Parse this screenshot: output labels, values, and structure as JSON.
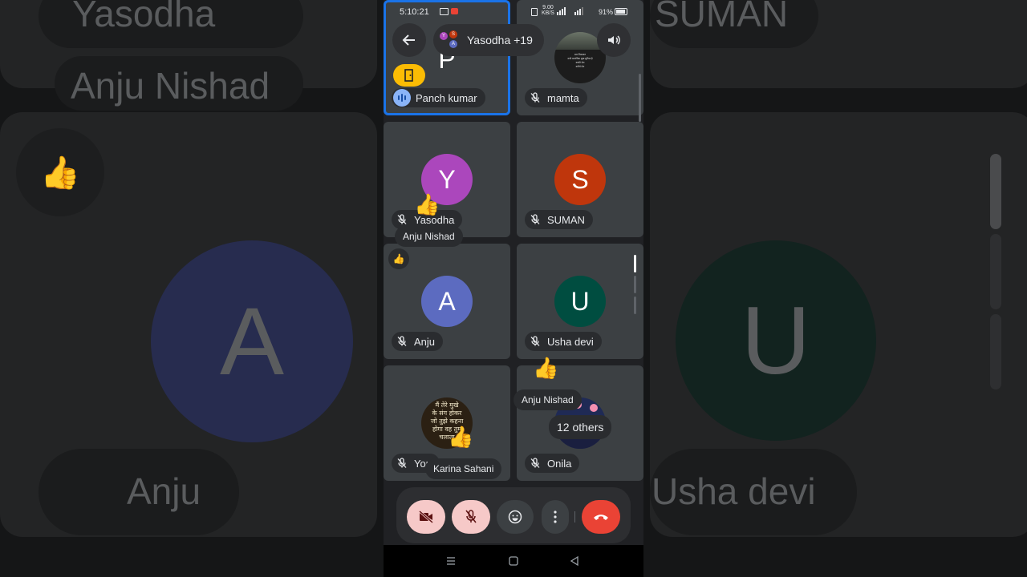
{
  "status_bar": {
    "time": "5:10:21",
    "net_speed_top": "9.00",
    "net_speed_bottom": "KB/S",
    "battery": "91%"
  },
  "header": {
    "participants_chip": "Yasodha +19",
    "mini_avatars": [
      "Y",
      "S",
      "A"
    ]
  },
  "tiles": [
    {
      "name": "Panch kumar",
      "initial": "P",
      "color": "#5c6bc0",
      "speaking": true,
      "active": true
    },
    {
      "name": "mamta",
      "initial": "",
      "color": "#444",
      "speaking": false,
      "photo": true
    },
    {
      "name": "Yasodha",
      "initial": "Y",
      "color": "#ab47bc",
      "speaking": false
    },
    {
      "name": "SUMAN",
      "initial": "S",
      "color": "#bf360c",
      "speaking": false
    },
    {
      "name": "Anju",
      "initial": "A",
      "color": "#5c6bc0",
      "speaking": false
    },
    {
      "name": "Usha devi",
      "initial": "U",
      "color": "#004d40",
      "speaking": false
    },
    {
      "name": "You",
      "initial": "",
      "color": "#333",
      "speaking": false,
      "photo": true
    },
    {
      "name": "Onila",
      "initial": "",
      "color": "#333",
      "speaking": false,
      "photo": true
    }
  ],
  "photo_text": {
    "mamta_lines": [
      "सब शिकायत",
      "सभी समाजिक सुख सुविधा है",
      "काफी मेरा",
      "करिये मेरा"
    ],
    "you_lines": [
      "मैं तेरे मुखे",
      "के संग होकर",
      "जो तुझे कहना",
      "होगा वह तुम",
      "चलाता"
    ]
  },
  "reactions": {
    "tile3_sender": "Anju Nishad",
    "tile6_sender": "Anju Nishad",
    "tile7_sender": "Karina Sahani",
    "others_chip": "12 others"
  },
  "background": {
    "top_left_name": "Yasodha",
    "left_name": "Anju Nishad",
    "top_right_name": "SUMAN",
    "bottom_left_name": "Anju",
    "bottom_right_name": "Usha devi",
    "left_initial": "A",
    "right_initial": "U"
  },
  "colors": {
    "end_call": "#ea4335",
    "muted_btn": "#f6c9c8",
    "active_outline": "#1a73e8",
    "speaking": "#8ab4f8",
    "hand_raise": "#fbbc04"
  }
}
